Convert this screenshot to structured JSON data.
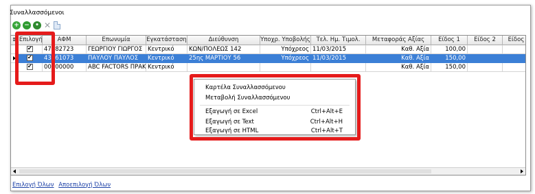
{
  "panel": {
    "title": "Συναλλασσόμενοι"
  },
  "toolbar": {
    "icons": [
      "add-icon",
      "remove-icon",
      "edit-icon",
      "delete-icon",
      "document-icon"
    ]
  },
  "grid": {
    "columns": [
      "Επιλογή",
      "ΑΦΜ",
      "Επωνυμία",
      "Εγκατάσταση",
      "Διεύθυνση",
      "Υποχρ. Υποβολής",
      "Τελ. Ημ. Τιμολ.",
      "Μεταφοράς Αξίας",
      "Είδος 1",
      "Είδος 2",
      "Είδος"
    ],
    "rows": [
      {
        "selected_check": true,
        "afm": "47082723",
        "name": "ΓΕΩΡΓΙΟΥ ΓΙΩΡΓΟΣ",
        "branch": "Κεντρικό",
        "address": "ΚΩΝ/ΠΟΛΕΩΣ 142",
        "obligation": "Υπόχρεος",
        "date": "11/03/2015",
        "transfer": "Καθ. Αξία",
        "item1": "100,00",
        "item2": ""
      },
      {
        "selected_check": true,
        "afm": "43561073",
        "name": "ΠΑΥΛΟΥ ΠΑΥΛΟΣ",
        "branch": "Κεντρικό",
        "address": "25ης ΜΑΡΤΙΟΥ 56",
        "obligation": "Υπόχρεος",
        "date": "11/03/2015",
        "transfer": "Καθ. Αξία",
        "item1": "150,00",
        "item2": ""
      },
      {
        "selected_check": true,
        "afm": "00000000",
        "name": "ABC FACTORS ΠΡΑΚΤ",
        "branch": "Κεντρικό",
        "address": "",
        "obligation": "",
        "date": "",
        "transfer": "Καθ. Αξία",
        "item1": "150,00",
        "item2": ""
      }
    ]
  },
  "context_menu": {
    "items": [
      {
        "label": "Καρτέλα Συναλλασσόμενου",
        "shortcut": ""
      },
      {
        "label": "Μεταβολή Συναλλασσόμενου",
        "shortcut": ""
      },
      {
        "label": "Εξαγωγή σε Excel",
        "shortcut": "Ctrl+Alt+E"
      },
      {
        "label": "Εξαγωγή σε Text",
        "shortcut": "Ctrl+Alt+H"
      },
      {
        "label": "Εξαγωγή σε HTML",
        "shortcut": "Ctrl+Alt+T"
      }
    ]
  },
  "footer": {
    "select_all": "Επιλογή Όλων",
    "deselect_all": "Αποεπιλογή Όλων"
  },
  "colors": {
    "highlight": "#e51b1b",
    "selection": "#3b7fd6",
    "link": "#1a3fa6"
  }
}
